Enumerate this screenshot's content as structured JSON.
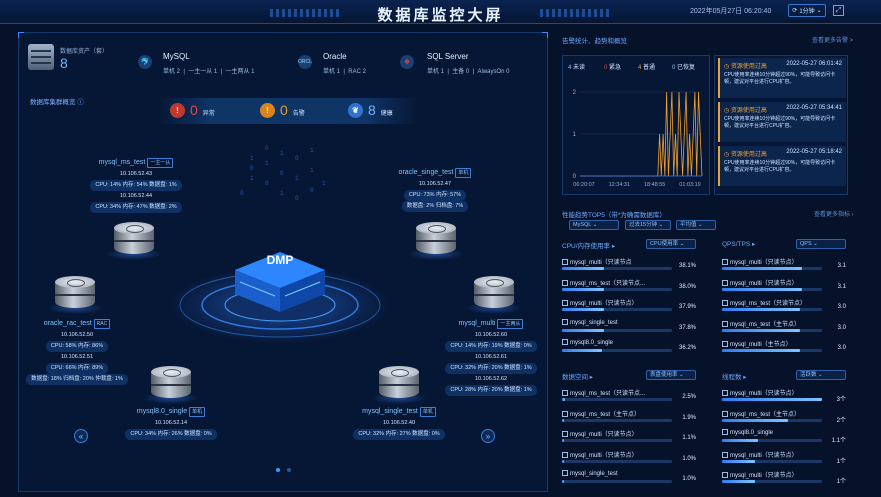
{
  "header": {
    "title": "数据库监控大屏",
    "datetime": "2022年05月27日 06:20:40",
    "refresh": "1分钟"
  },
  "overview": {
    "asset_label": "数据库资产（套）",
    "asset_count": "8",
    "types": [
      {
        "name": "MySQL",
        "stats": [
          "单机 2",
          "一主一从 1",
          "一主两从 1"
        ]
      },
      {
        "name": "Oracle",
        "stats": [
          "单机 1",
          "RAC 2"
        ]
      },
      {
        "name": "SQL Server",
        "stats": [
          "单机 1",
          "主备 0",
          "AlwaysOn 0"
        ]
      }
    ]
  },
  "cluster": {
    "title": "数据库集群概览",
    "status": [
      {
        "count": "0",
        "label": "异常",
        "color": "#e8463a"
      },
      {
        "count": "0",
        "label": "告警",
        "color": "#f09a25"
      },
      {
        "count": "8",
        "label": "健康",
        "color": "#3b8cf0"
      }
    ],
    "center": "DMP",
    "nodes": [
      {
        "name": "mysql_ms_test",
        "tag": "一主一从",
        "lines": [
          "10.106.52.43",
          "CPU: 14% 内存: 54% 数据盘: 1%",
          "10.106.52.44",
          "CPU: 34% 内存: 47% 数据盘: 2%"
        ]
      },
      {
        "name": "oracle_singe_test",
        "tag": "单机",
        "lines": [
          "10.106.52.47",
          "CPU: 73% 内存: 57%",
          "数据盘: 2% 归档盘: 7%"
        ]
      },
      {
        "name": "oracle_rac_test",
        "tag": "RAC",
        "lines": [
          "10.106.52.50",
          "CPU: 58% 内存: 86%",
          "10.106.52.51",
          "CPU: 66% 内存: 89%",
          "数据盘: 18% 归档盘: 20% 仲裁盘: 1%"
        ]
      },
      {
        "name": "mysql_multi",
        "tag": "一主两从",
        "lines": [
          "10.106.52.60",
          "CPU: 14% 内存: 19% 数据盘: 0%",
          "10.106.52.61",
          "CPU: 32% 内存: 20% 数据盘: 1%",
          "10.106.52.62",
          "CPU: 28% 内存: 20% 数据盘: 1%"
        ]
      },
      {
        "name": "mysql8.0_single",
        "tag": "单机",
        "lines": [
          "10.106.52.14",
          "CPU: 34% 内存: 26% 数据盘: 0%"
        ]
      },
      {
        "name": "mysql_single_test",
        "tag": "单机",
        "lines": [
          "10.106.52.40",
          "CPU: 32% 内存: 27% 数据盘: 0%"
        ]
      }
    ],
    "prev": "«",
    "next": "»"
  },
  "alerts": {
    "title": "告警统计、趋势和概览",
    "more": "查看更多告警 >",
    "legend": [
      {
        "count": "4",
        "label": "未读",
        "color": "#7fc3ff"
      },
      {
        "count": "0",
        "label": "紧急",
        "color": "#e8463a"
      },
      {
        "count": "4",
        "label": "普通",
        "color": "#f0a030"
      },
      {
        "count": "0",
        "label": "已恢复",
        "color": "#7fc3ff"
      }
    ],
    "items": [
      {
        "title": "资源使用过高",
        "time": "2022-05-27 06:01:42",
        "body": "CPU使用率连续10分钟超过90%，可能导致访问卡顿，建议对平台进行CPU扩容。"
      },
      {
        "title": "资源使用过高",
        "time": "2022-05-27 05:34:41",
        "body": "CPU使用率连续10分钟超过90%，可能导致访问卡顿，建议对平台进行CPU扩容。"
      },
      {
        "title": "资源使用过高",
        "time": "2022-05-27 05:18:42",
        "body": "CPU使用率连续10分钟超过90%，可能导致访问卡顿，建议对平台进行CPU扩容。"
      }
    ]
  },
  "chart_data": {
    "type": "line",
    "x_ticks": [
      "06:20:07",
      "12:34:31",
      "18:48:55",
      "01:03:19"
    ],
    "ylim": [
      0,
      2
    ],
    "y_ticks": [
      "0",
      "1",
      "2"
    ],
    "series": [
      {
        "color": "#f0a030",
        "values": [
          0,
          0,
          0,
          0,
          0,
          0,
          0,
          0,
          0,
          0,
          0,
          0,
          0,
          0,
          0,
          0,
          0,
          0,
          0,
          0,
          0,
          0,
          0,
          0,
          0,
          0,
          0,
          0,
          0,
          0,
          0,
          0,
          0,
          0,
          0,
          0,
          0,
          0,
          0,
          0,
          0,
          0,
          0,
          0,
          0,
          1,
          0,
          1,
          0,
          2,
          0,
          1,
          2,
          0,
          1,
          0,
          2,
          1,
          0,
          1,
          2,
          0,
          1,
          0,
          1,
          2,
          0,
          2,
          1,
          0
        ]
      },
      {
        "color": "#2d7cf0",
        "values": [
          0,
          0,
          0,
          0,
          0,
          0,
          0,
          0,
          0,
          0,
          0,
          0,
          0,
          0,
          0,
          0,
          0,
          0,
          0,
          0,
          0,
          0,
          0,
          0,
          0,
          0,
          0,
          0,
          0,
          0,
          0,
          0,
          0,
          0,
          0,
          0,
          0,
          0,
          0,
          0,
          0,
          0,
          0,
          0,
          0,
          0,
          0,
          0,
          0,
          0,
          0,
          0,
          0,
          0,
          0,
          0,
          0,
          0,
          0,
          0,
          0,
          0,
          0,
          0,
          0,
          0,
          0,
          0,
          0,
          0
        ]
      }
    ]
  },
  "perf": {
    "title": "性能趋势TOP5（带*为确需数据库）",
    "more": "查看更多指标",
    "filters": [
      "MySQL",
      "过去15分钟",
      "平均值"
    ],
    "panels": [
      {
        "title": "CPU/内存使用率",
        "select": "CPU使用率",
        "rows": [
          {
            "name": "mysql_multi（只读节点",
            "value": "38.1%",
            "pct": 38.1
          },
          {
            "name": "mysql_ms_test（只读节点...",
            "value": "38.0%",
            "pct": 38.0
          },
          {
            "name": "mysql_multi（只读节点）",
            "value": "37.9%",
            "pct": 37.9
          },
          {
            "name": "mysql_single_test",
            "value": "37.8%",
            "pct": 37.8
          },
          {
            "name": "mysql8.0_single",
            "value": "36.2%",
            "pct": 36.2
          }
        ]
      },
      {
        "title": "QPS/TPS",
        "select": "QPS",
        "rows": [
          {
            "name": "mysql_multi（只读节点）",
            "value": "3.1",
            "pct": 80
          },
          {
            "name": "mysql_multi（只读节点）",
            "value": "3.1",
            "pct": 80
          },
          {
            "name": "mysql_ms_test（只读节点）",
            "value": "3.0",
            "pct": 78
          },
          {
            "name": "mysql_ms_test（主节点）",
            "value": "3.0",
            "pct": 78
          },
          {
            "name": "mysql_multi（主节点）",
            "value": "3.0",
            "pct": 78
          }
        ]
      },
      {
        "title": "数据空间",
        "select": "表盘使用率",
        "rows": [
          {
            "name": "mysql_ms_test（只读节点...",
            "value": "2.5%",
            "pct": 2.5
          },
          {
            "name": "mysql_ms_test（主节点）",
            "value": "1.9%",
            "pct": 1.9
          },
          {
            "name": "mysql_multi（只读节点）",
            "value": "1.1%",
            "pct": 1.1
          },
          {
            "name": "mysql_multi（只读节点）",
            "value": "1.0%",
            "pct": 1.0
          },
          {
            "name": "mysql_single_test",
            "value": "1.0%",
            "pct": 1.0
          }
        ]
      },
      {
        "title": "线程数",
        "select": "活跃数",
        "rows": [
          {
            "name": "mysql_multi（只读节点）",
            "value": "3个",
            "pct": 100
          },
          {
            "name": "mysql_ms_test（主节点）",
            "value": "2个",
            "pct": 66
          },
          {
            "name": "mysql8.0_single",
            "value": "1.1个",
            "pct": 36
          },
          {
            "name": "mysql_multi（只读节点）",
            "value": "1个",
            "pct": 33
          },
          {
            "name": "mysql_multi（只读节点）",
            "value": "1个",
            "pct": 33
          }
        ]
      }
    ]
  }
}
